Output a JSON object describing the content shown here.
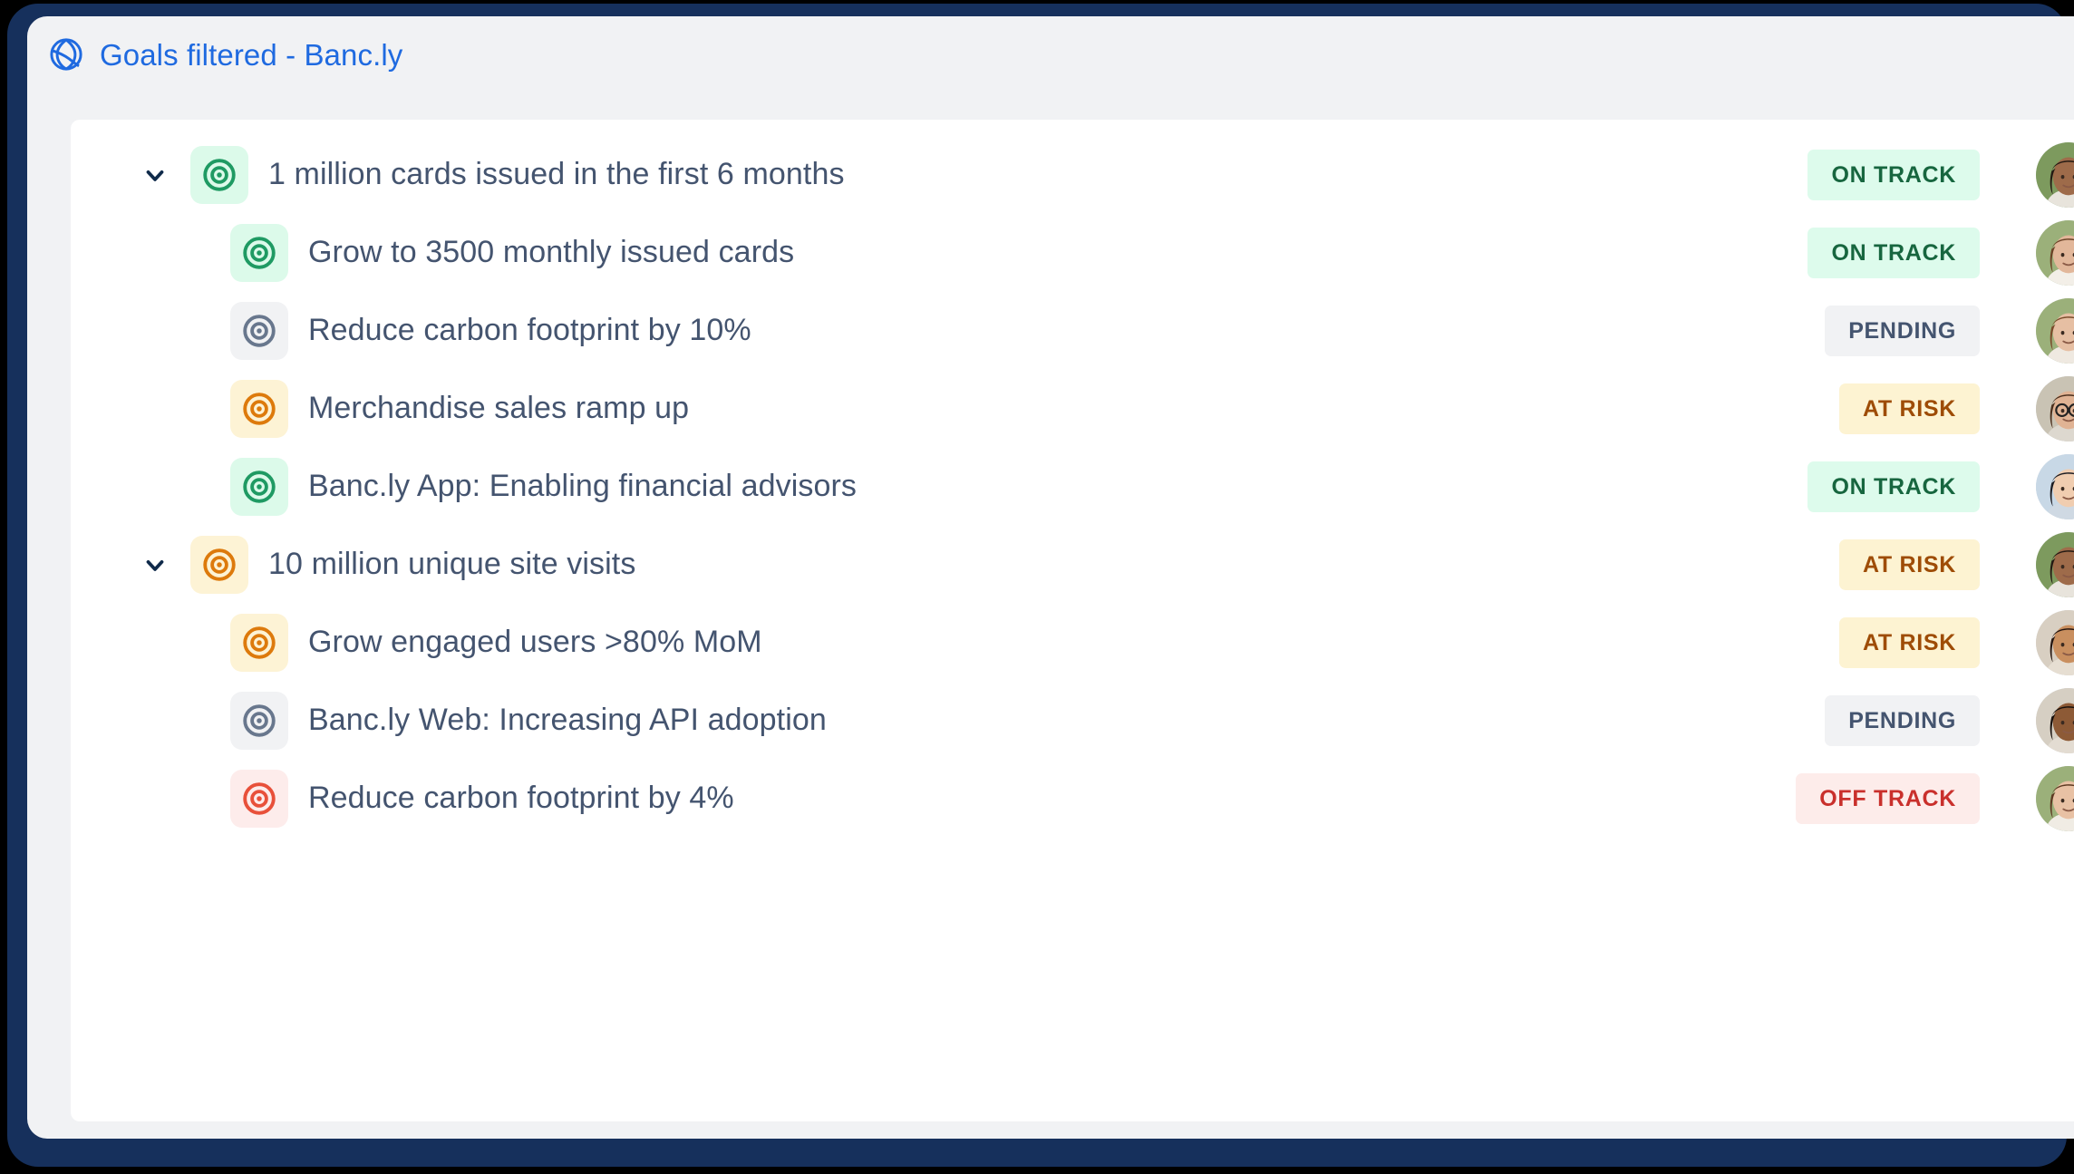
{
  "window": {
    "frame_color": "#16305c",
    "panel_bg": "#f1f2f4",
    "card_bg": "#ffffff"
  },
  "header": {
    "icon": "atlas-globe-icon",
    "title": "Goals filtered - Banc.ly",
    "title_color": "#1f6ae0"
  },
  "status_styles": {
    "ON TRACK": {
      "bg": "#ddfbec",
      "fg": "#17663f"
    },
    "PENDING": {
      "bg": "#f1f2f4",
      "fg": "#44546f"
    },
    "AT RISK": {
      "bg": "#fdf3d2",
      "fg": "#9e4c06"
    },
    "OFF TRACK": {
      "bg": "#fdecea",
      "fg": "#c9302c"
    }
  },
  "icon_styles": {
    "green": {
      "bg": "#dcfaea",
      "fg": "#1f9a63"
    },
    "gray": {
      "bg": "#f1f2f4",
      "fg": "#68778d"
    },
    "orange": {
      "bg": "#fdf3d5",
      "fg": "#dd7a0c"
    },
    "red": {
      "bg": "#fdeceb",
      "fg": "#e8503a"
    }
  },
  "goals": [
    {
      "level": "parent",
      "expanded": true,
      "chevron": "chevron-down-icon",
      "icon": "target-icon",
      "icon_tone": "green",
      "name": "1 million cards issued in the first 6 months",
      "status": "ON TRACK",
      "avatar": "avatar-male-1"
    },
    {
      "level": "child",
      "icon": "target-icon",
      "icon_tone": "green",
      "name": "Grow to 3500 monthly issued cards",
      "status": "ON TRACK",
      "avatar": "avatar-female-1"
    },
    {
      "level": "child",
      "icon": "target-icon",
      "icon_tone": "gray",
      "name": "Reduce carbon footprint by 10%",
      "status": "PENDING",
      "avatar": "avatar-female-2"
    },
    {
      "level": "child",
      "icon": "target-icon",
      "icon_tone": "orange",
      "name": "Merchandise sales ramp up",
      "status": "AT RISK",
      "avatar": "avatar-female-glasses"
    },
    {
      "level": "child",
      "icon": "target-icon",
      "icon_tone": "green",
      "name": "Banc.ly App: Enabling financial advisors",
      "status": "ON TRACK",
      "avatar": "avatar-female-3"
    },
    {
      "level": "parent",
      "expanded": true,
      "chevron": "chevron-down-icon",
      "icon": "target-icon",
      "icon_tone": "orange",
      "name": "10 million unique site visits",
      "status": "AT RISK",
      "avatar": "avatar-male-1"
    },
    {
      "level": "child",
      "icon": "target-icon",
      "icon_tone": "orange",
      "name": "Grow engaged users >80% MoM",
      "status": "AT RISK",
      "avatar": "avatar-female-4"
    },
    {
      "level": "child",
      "icon": "target-icon",
      "icon_tone": "gray",
      "name": "Banc.ly Web: Increasing API adoption",
      "status": "PENDING",
      "avatar": "avatar-male-2"
    },
    {
      "level": "child",
      "icon": "target-icon",
      "icon_tone": "red",
      "name": "Reduce carbon footprint by 4%",
      "status": "OFF TRACK",
      "avatar": "avatar-female-5"
    }
  ]
}
